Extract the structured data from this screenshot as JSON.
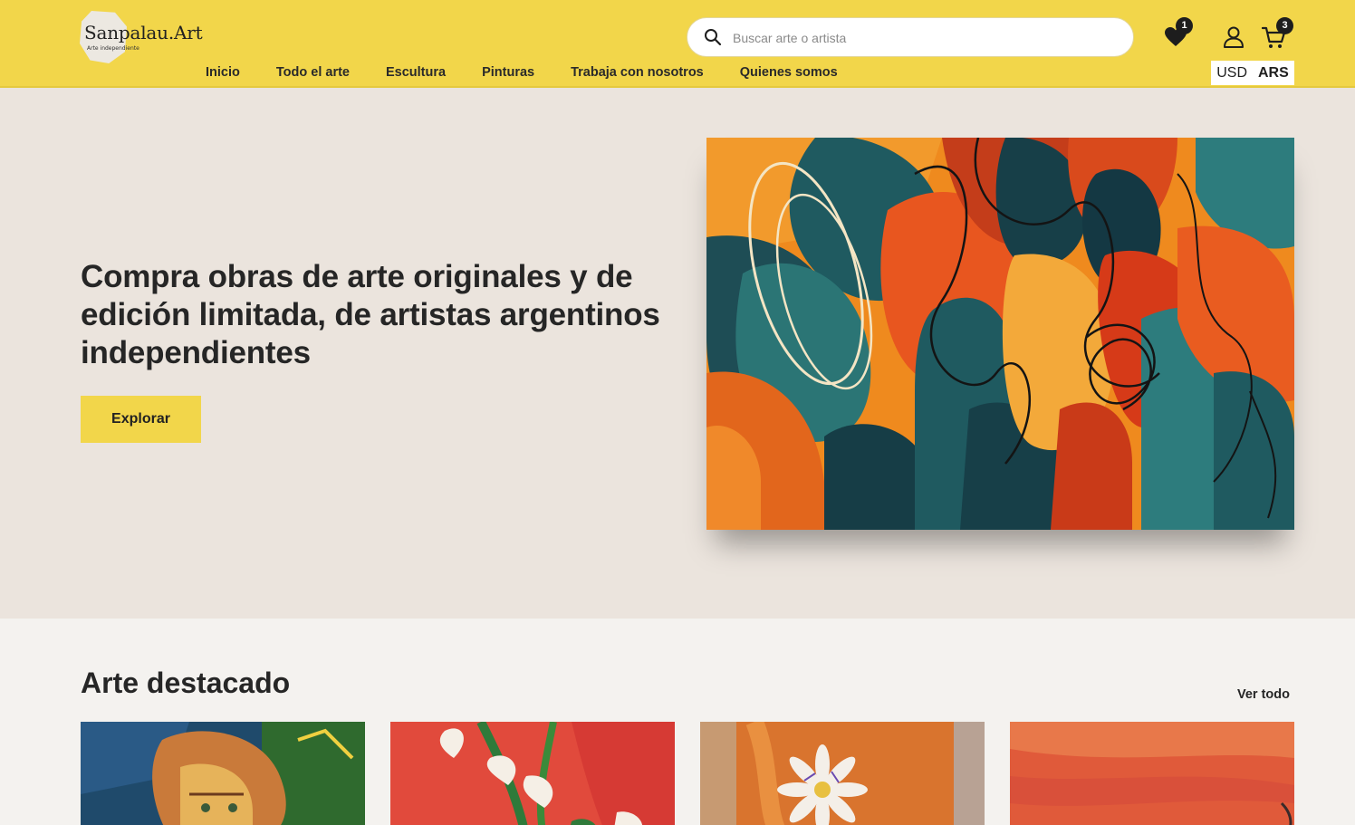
{
  "brand": {
    "name": "Sanpalau.Art",
    "tagline": "Arte independiente"
  },
  "nav": {
    "items": [
      "Inicio",
      "Todo el arte",
      "Escultura",
      "Pinturas",
      "Trabaja con nosotros",
      "Quienes somos"
    ]
  },
  "search": {
    "placeholder": "Buscar arte o artista"
  },
  "badges": {
    "favorites": "1",
    "cart": "3"
  },
  "icons": {
    "search": "search-icon",
    "favorites": "heart-icon",
    "account": "user-icon",
    "cart": "cart-icon"
  },
  "currency": {
    "options": [
      "USD",
      "ARS"
    ],
    "selected": "ARS"
  },
  "hero": {
    "title": "Compra obras de arte originales y de edición limitada, de artistas argentinos independientes",
    "button": "Explorar"
  },
  "featured": {
    "title": "Arte destacado",
    "see_all": "Ver todo"
  },
  "colors": {
    "header": "#f2d64a",
    "hero_bg": "#ebe4dd",
    "page_bg": "#f4f2ef",
    "text": "#262626"
  }
}
